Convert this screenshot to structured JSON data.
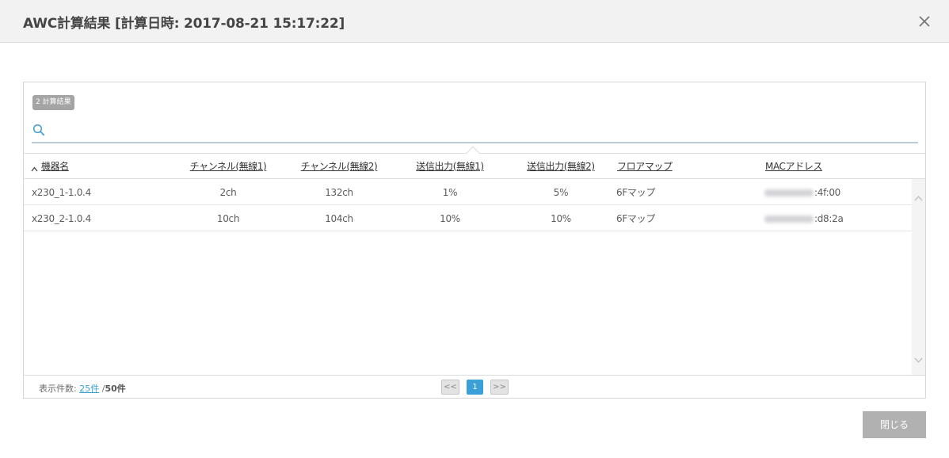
{
  "dialog": {
    "title": "AWC計算結果 [計算日時: 2017-08-21 15:17:22]",
    "close_button_label": "閉じる"
  },
  "results": {
    "count_badge": "2 計算結果",
    "search": {
      "value": "",
      "placeholder": ""
    },
    "columns": [
      {
        "key": "device_name",
        "label": "機器名",
        "sort": "ascending"
      },
      {
        "key": "channel1",
        "label": "チャンネル(無線1)"
      },
      {
        "key": "channel2",
        "label": "チャンネル(無線2)"
      },
      {
        "key": "power1",
        "label": "送信出力(無線1)"
      },
      {
        "key": "power2",
        "label": "送信出力(無線2)"
      },
      {
        "key": "floormap",
        "label": "フロアマップ"
      },
      {
        "key": "mac",
        "label": "MACアドレス"
      }
    ],
    "rows": [
      {
        "device_name": "x230_1-1.0.4",
        "channel1": "2ch",
        "channel2": "132ch",
        "power1": "1%",
        "power2": "5%",
        "floormap": "6Fマップ",
        "mac_visible": ":4f:00"
      },
      {
        "device_name": "x230_2-1.0.4",
        "channel1": "10ch",
        "channel2": "104ch",
        "power1": "10%",
        "power2": "10%",
        "floormap": "6Fマップ",
        "mac_visible": ":d8:2a"
      }
    ]
  },
  "footer": {
    "page_size_label": "表示件数:",
    "page_size_current": "25件",
    "page_size_separator": "/",
    "page_size_alt": "50件",
    "pager": {
      "first": "<<",
      "current": "1",
      "last": ">>"
    }
  },
  "icons": {
    "close": "close-icon",
    "search": "search-icon",
    "sort": "sort-ascending-icon",
    "scroll_up": "chevron-up-icon",
    "scroll_down": "chevron-down-icon"
  },
  "colors": {
    "header_bg": "#f2f2f3",
    "accent": "#3b9fd9",
    "badge_bg": "#a4a4a4",
    "button_bg": "#b1b1b1"
  }
}
